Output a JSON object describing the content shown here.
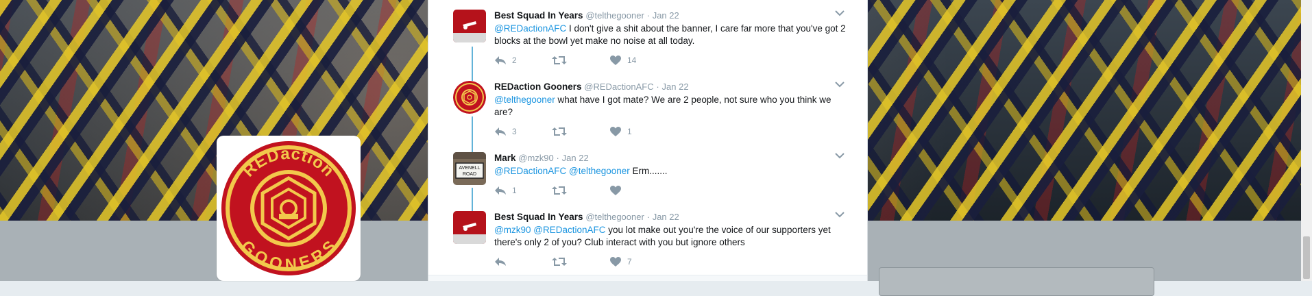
{
  "profile": {
    "avatar_top_text": "REDaction",
    "avatar_bottom_text": "GOONERS"
  },
  "colors": {
    "link": "#1b95e0",
    "thread_line": "#63b3d8",
    "muted": "#8899a6",
    "arsenal_red": "#c1121f"
  },
  "tweets": [
    {
      "name": "Best Squad In Years",
      "handle": "@telthegooner",
      "dot": "·",
      "date": "Jan 22",
      "mentions": [
        "@REDactionAFC"
      ],
      "text": " I don't give a shit about the banner, I care far more that you've got 2 blocks at the bowl yet make no noise at all today.",
      "reply_count": "2",
      "retweet_count": "",
      "like_count": "14",
      "avatar_icon": "cannon-icon"
    },
    {
      "name": "REDaction Gooners",
      "handle": "@REDactionAFC",
      "dot": "·",
      "date": "Jan 22",
      "mentions": [
        "@telthegooner"
      ],
      "text": " what have I got mate? We are 2 people, not sure who you think we are?",
      "reply_count": "3",
      "retweet_count": "",
      "like_count": "1",
      "avatar_icon": "redaction-crest-icon"
    },
    {
      "name": "Mark",
      "handle": "@mzk90",
      "dot": "·",
      "date": "Jan 22",
      "mentions": [
        "@REDactionAFC",
        "@telthegooner"
      ],
      "text": " Erm.......",
      "reply_count": "1",
      "retweet_count": "",
      "like_count": "",
      "avatar_icon": "street-sign-icon",
      "avatar_sign_line1": "AVENELL",
      "avatar_sign_line2": "ROAD"
    },
    {
      "name": "Best Squad In Years",
      "handle": "@telthegooner",
      "dot": "·",
      "date": "Jan 22",
      "mentions": [
        "@mzk90",
        "@REDactionAFC"
      ],
      "text": " you lot make out you're the voice of our supporters yet there's only 2 of you? Club interact with you but ignore others",
      "reply_count": "",
      "retweet_count": "",
      "like_count": "7",
      "avatar_icon": "cannon-icon"
    }
  ]
}
